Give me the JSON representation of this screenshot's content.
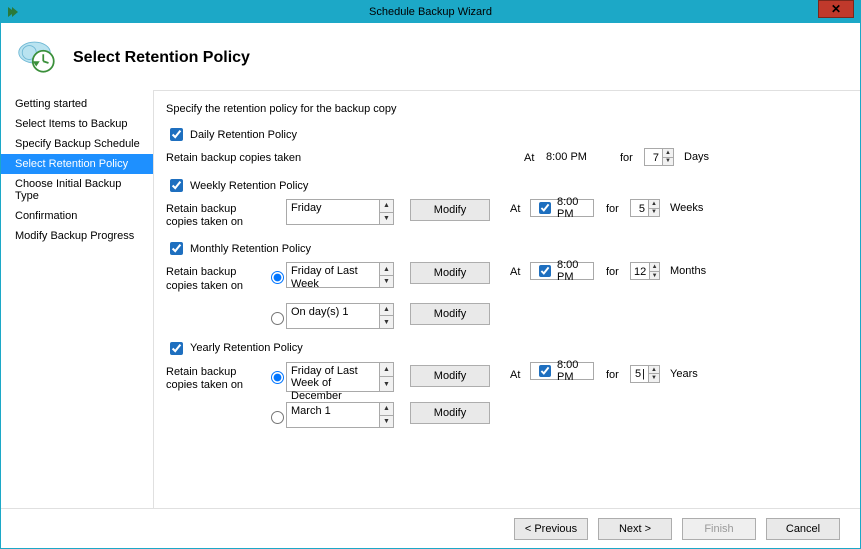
{
  "window": {
    "title": "Schedule Backup Wizard",
    "close_glyph": "✕"
  },
  "header": {
    "title": "Select Retention Policy"
  },
  "sidebar": {
    "items": [
      {
        "label": "Getting started"
      },
      {
        "label": "Select Items to Backup"
      },
      {
        "label": "Specify Backup Schedule"
      },
      {
        "label": "Select Retention Policy"
      },
      {
        "label": "Choose Initial Backup Type"
      },
      {
        "label": "Confirmation"
      },
      {
        "label": "Modify Backup Progress"
      }
    ],
    "active_index": 3
  },
  "main": {
    "instruction": "Specify the retention policy for the backup copy",
    "daily": {
      "check_label": "Daily Retention Policy",
      "checked": true,
      "retain_label": "Retain backup copies taken",
      "at_label": "At",
      "at_value": "8:00 PM",
      "for_label": "for",
      "num_value": "7",
      "unit_label": "Days"
    },
    "weekly": {
      "check_label": "Weekly Retention Policy",
      "checked": true,
      "retain_label": "Retain backup copies taken on",
      "sched_value": "Friday",
      "modify_label": "Modify",
      "at_label": "At",
      "at_value": "8:00 PM",
      "at_checked": true,
      "for_label": "for",
      "num_value": "5",
      "unit_label": "Weeks"
    },
    "monthly": {
      "check_label": "Monthly Retention Policy",
      "checked": true,
      "retain_label": "Retain backup copies taken on",
      "opt1_value": "Friday of Last Week",
      "opt2_value": "On day(s) 1",
      "modify_label": "Modify",
      "at_label": "At",
      "at_value": "8:00 PM",
      "at_checked": true,
      "for_label": "for",
      "num_value": "12",
      "unit_label": "Months"
    },
    "yearly": {
      "check_label": "Yearly Retention Policy",
      "checked": true,
      "retain_label": "Retain backup copies taken on",
      "opt1_value": "Friday of Last Week of December",
      "opt2_value": "March 1",
      "modify_label": "Modify",
      "at_label": "At",
      "at_value": "8:00 PM",
      "at_checked": true,
      "for_label": "for",
      "num_value": "5",
      "num_caret": true,
      "unit_label": "Years"
    }
  },
  "footer": {
    "previous": "< Previous",
    "next": "Next >",
    "finish": "Finish",
    "cancel": "Cancel"
  },
  "glyphs": {
    "up": "▲",
    "down": "▼"
  }
}
